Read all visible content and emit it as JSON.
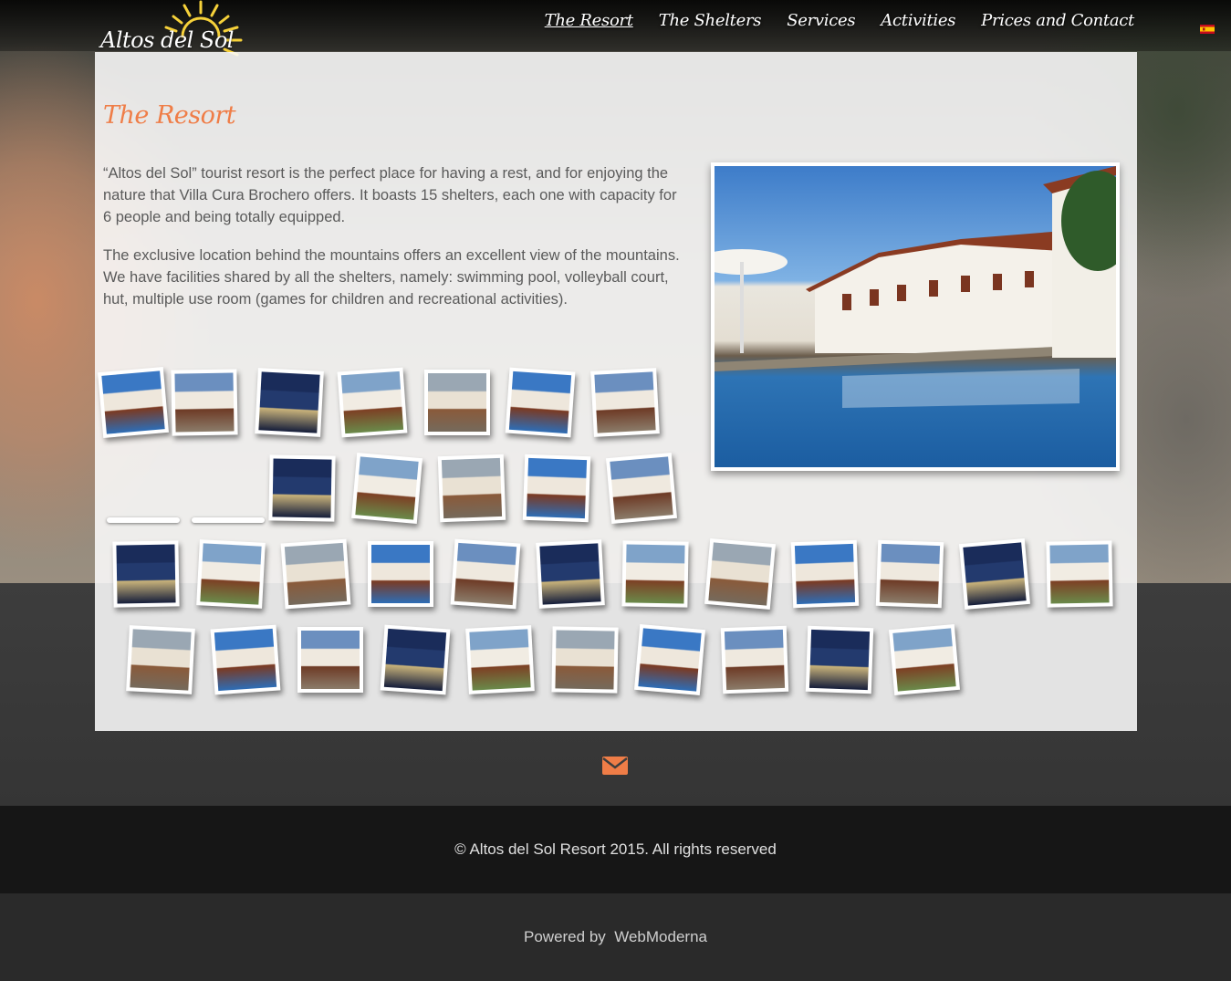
{
  "site": {
    "logo_text": "Altos del Sol"
  },
  "nav": {
    "items": [
      {
        "label": "The Resort",
        "active": true
      },
      {
        "label": "The Shelters",
        "active": false
      },
      {
        "label": "Services",
        "active": false
      },
      {
        "label": "Activities",
        "active": false
      },
      {
        "label": "Prices and Contact",
        "active": false
      }
    ],
    "language_icon": "spanish-flag-icon"
  },
  "page": {
    "title": "The Resort",
    "paragraphs": [
      "“Altos del Sol” tourist resort is the perfect place for having a rest, and for enjoying the nature that Villa Cura Brochero offers. It boasts 15 shelters, each one with capacity for 6 people and being totally equipped.",
      "The exclusive location behind the mountains offers an excellent view of the mountains.",
      "We have facilities shared by all the shelters, namely: swimming pool, volleyball court, hut, multiple use room (games for children and recreational activities)."
    ]
  },
  "gallery": {
    "thumbnail_count": 36,
    "icon": "photo-thumbnail"
  },
  "footer": {
    "mail_icon": "envelope-icon",
    "copyright": "© Altos del Sol Resort 2015. All rights reserved",
    "powered_prefix": "Powered by",
    "powered_link": "WebModerna"
  },
  "colors": {
    "accent": "#ef7d47",
    "panel": "#fafafa",
    "footer_dark": "#161616"
  }
}
